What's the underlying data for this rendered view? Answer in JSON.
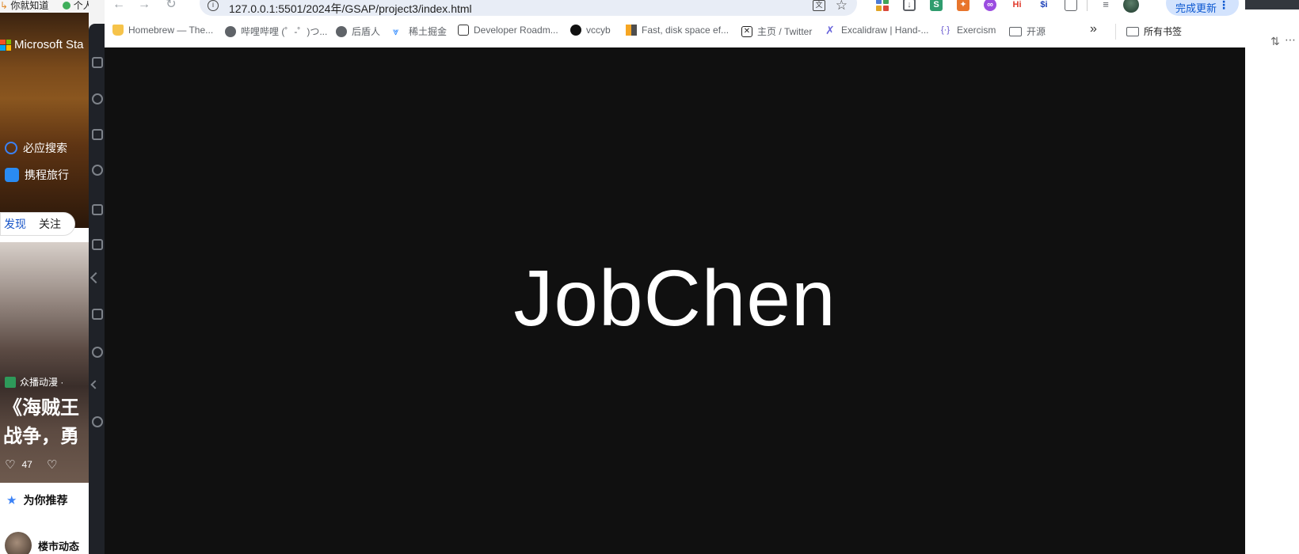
{
  "msn": {
    "bookmark_1": "你就知道",
    "bookmark_2": "个人",
    "brand": "Microsoft Sta",
    "quick_links": [
      {
        "label": "必应搜索",
        "icon": "bing-search-icon"
      },
      {
        "label": "携程旅行",
        "icon": "ctrip-icon"
      }
    ],
    "tabs": [
      "发现",
      "关注"
    ],
    "card": {
      "source": "众播动漫 ·",
      "headline_line1": "《海贼王",
      "headline_line2": "战争，勇",
      "likes": "47"
    },
    "recommend_label": "为你推荐",
    "section2_label": "楼市动态"
  },
  "chrome": {
    "url": "127.0.0.1:5501/2024年/GSAP/project3/index.html",
    "update_label": "完成更新",
    "extensions": [
      "grid-extension-icon",
      "download-extension-icon",
      "s-extension-icon",
      "fox-extension-icon",
      "link-extension-icon",
      "hi-extension-icon",
      "si-extension-icon",
      "puzzle-extension-icon"
    ],
    "bookmarks": [
      {
        "label": "Homebrew — The...",
        "icon": "homebrew-icon"
      },
      {
        "label": "哔哩哔哩 (゜-゜)つ...",
        "icon": "globe-icon"
      },
      {
        "label": "后盾人",
        "icon": "globe-icon"
      },
      {
        "label": "稀土掘金",
        "icon": "juejin-icon"
      },
      {
        "label": "Developer Roadm...",
        "icon": "roadmap-icon"
      },
      {
        "label": "vccyb",
        "icon": "github-icon"
      },
      {
        "label": "Fast, disk space ef...",
        "icon": "pnpm-icon"
      },
      {
        "label": "主页 / Twitter",
        "icon": "x-icon"
      },
      {
        "label": "Excalidraw | Hand-...",
        "icon": "excalidraw-icon"
      },
      {
        "label": "Exercism",
        "icon": "exercism-icon"
      },
      {
        "label": "开源",
        "icon": "folder-icon"
      }
    ],
    "overflow": "»",
    "all_bookmarks": "所有书签"
  },
  "page": {
    "hero_text": "JobChen",
    "background": "#101010"
  }
}
